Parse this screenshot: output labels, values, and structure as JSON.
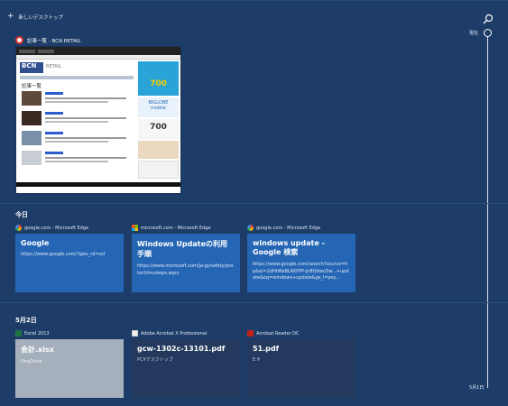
{
  "topbar": {
    "new_desktop_label": "新しいデスクトップ"
  },
  "timeline": {
    "now_label": "現在",
    "bottom_date": "5月1日"
  },
  "open_window": {
    "title": "記事一覧 - BCN RETAIL",
    "thumb": {
      "logo": "BCN",
      "brand": "RETAIL",
      "heading": "記事一覧",
      "ad_big_text": "700",
      "ad_text_2": "700",
      "ad_biglobe": "BIGLOBE",
      "ad_mobile": "mobile"
    }
  },
  "today": {
    "heading": "今日",
    "cards": [
      {
        "app": "google.com - Microsoft Edge",
        "title": "Google",
        "url": "https://www.google.com/?gws_rd=ssl"
      },
      {
        "app": "microsoft.com - Microsoft Edge",
        "title": "Windows Updateの利用手順",
        "url": "https://www.microsoft.com/ja-jp/safety/protect/musteps.aspx"
      },
      {
        "app": "google.com - Microsoft Edge",
        "title": "windows update - Google 検索",
        "url": "https://www.google.com/search?source=hp&ei=2dHtWaBLKKFPP-jn8QdwcDw...+update&oq=windows+update&gs_l=psy..."
      }
    ]
  },
  "may2": {
    "heading": "5月2日",
    "cards": [
      {
        "app": "Excel 2013",
        "title": "会計.xlsx",
        "sub": "OneDrive"
      },
      {
        "app": "Adobe Acrobat X Professional",
        "title": "gcw-1302c-13101.pdf",
        "sub": "PC¥デスクトップ"
      },
      {
        "app": "Acrobat Reader DC",
        "title": "51.pdf",
        "sub": "E:¥"
      }
    ]
  },
  "colors": {
    "background": "#1d3c68",
    "card_blue": "#2566b4",
    "card_dark": "#233a5e",
    "card_selected": "#a6b0bd"
  }
}
